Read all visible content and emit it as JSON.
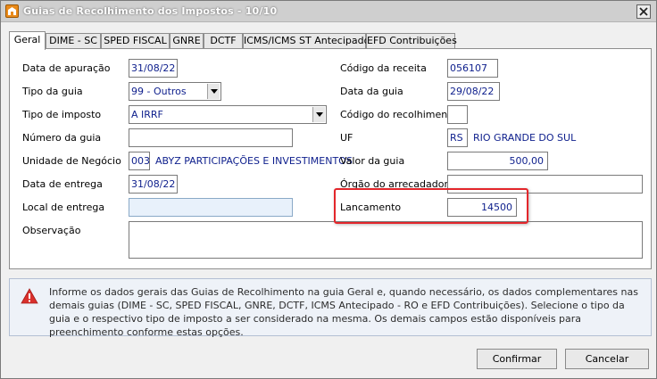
{
  "window": {
    "title": "Guias de Recolhimento dos Impostos - 10/10"
  },
  "tabs": [
    {
      "label": "Geral"
    },
    {
      "label": "DIME - SC"
    },
    {
      "label": "SPED FISCAL"
    },
    {
      "label": "GNRE"
    },
    {
      "label": "DCTF"
    },
    {
      "label": "ICMS/ICMS ST Antecipado"
    },
    {
      "label": "EFD Contribuições"
    }
  ],
  "form": {
    "data_apuracao": {
      "label": "Data de apuração",
      "value": "31/08/22"
    },
    "tipo_guia": {
      "label": "Tipo da guia",
      "value": "99 - Outros"
    },
    "tipo_imposto": {
      "label": "Tipo de imposto",
      "value": "A IRRF"
    },
    "numero_guia": {
      "label": "Número da guia",
      "value": ""
    },
    "unidade_negocio": {
      "label": "Unidade de Negócio",
      "code": "003",
      "name": "ABYZ PARTICIPAÇÕES E INVESTIMENTOS"
    },
    "data_entrega": {
      "label": "Data de entrega",
      "value": "31/08/22"
    },
    "local_entrega": {
      "label": "Local de entrega",
      "value": ""
    },
    "observacao": {
      "label": "Observação",
      "value": ""
    },
    "codigo_receita": {
      "label": "Código da receita",
      "value": "056107"
    },
    "data_guia": {
      "label": "Data da guia",
      "value": "29/08/22"
    },
    "codigo_recolhimento": {
      "label": "Código do recolhimento",
      "value": ""
    },
    "uf": {
      "label": "UF",
      "code": "RS",
      "name": "RIO GRANDE DO SUL"
    },
    "valor_guia": {
      "label": "Valor da guia",
      "value": "500,00"
    },
    "orgao_arrecadador": {
      "label": "Órgão do arrecadador",
      "value": ""
    },
    "lancamento": {
      "label": "Lancamento",
      "value": "14500"
    }
  },
  "info": {
    "text": "Informe os dados gerais das Guias de Recolhimento na guia Geral e, quando necessário, os dados complementares nas demais guias (DIME - SC, SPED FISCAL, GNRE, DCTF, ICMS Antecipado - RO e EFD Contribuições). Selecione o tipo da guia e o respectivo tipo de imposto a ser considerado na mesma. Os demais campos estão disponíveis para preenchimento conforme estas opções."
  },
  "buttons": {
    "confirm": "Confirmar",
    "cancel": "Cancelar"
  },
  "colors": {
    "field_text": "#0d1e8c",
    "highlight": "#e3262b",
    "warning": "#d9302c"
  }
}
